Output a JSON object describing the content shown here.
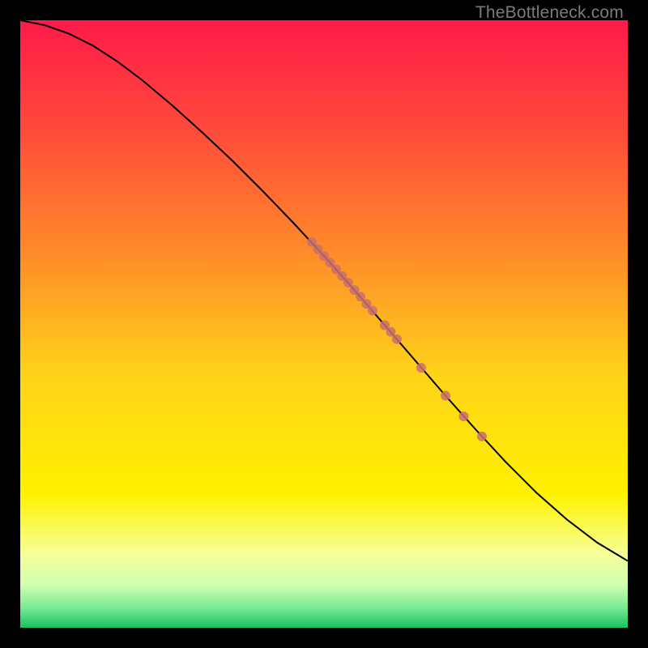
{
  "watermark": "TheBottleneck.com",
  "chart_data": {
    "type": "line",
    "title": "",
    "xlabel": "",
    "ylabel": "",
    "xlim": [
      0,
      100
    ],
    "ylim": [
      0,
      100
    ],
    "grid": false,
    "legend": false,
    "background_gradient": {
      "stops": [
        {
          "offset": 0.0,
          "color": "#ff1a4a"
        },
        {
          "offset": 0.18,
          "color": "#ff4a3a"
        },
        {
          "offset": 0.38,
          "color": "#ff8a2a"
        },
        {
          "offset": 0.58,
          "color": "#ffd21a"
        },
        {
          "offset": 0.78,
          "color": "#fff200"
        },
        {
          "offset": 0.88,
          "color": "#f6ff9a"
        },
        {
          "offset": 0.93,
          "color": "#d0ffb0"
        },
        {
          "offset": 0.97,
          "color": "#70e890"
        },
        {
          "offset": 1.0,
          "color": "#18c060"
        }
      ]
    },
    "series": [
      {
        "name": "curve",
        "style": "line",
        "color": "#000000",
        "points": [
          {
            "x": 0,
            "y": 100
          },
          {
            "x": 4,
            "y": 99.2
          },
          {
            "x": 8,
            "y": 97.8
          },
          {
            "x": 12,
            "y": 95.8
          },
          {
            "x": 16,
            "y": 93.2
          },
          {
            "x": 20,
            "y": 90.2
          },
          {
            "x": 25,
            "y": 86.0
          },
          {
            "x": 30,
            "y": 81.5
          },
          {
            "x": 35,
            "y": 76.8
          },
          {
            "x": 40,
            "y": 71.8
          },
          {
            "x": 45,
            "y": 66.6
          },
          {
            "x": 50,
            "y": 61.2
          },
          {
            "x": 55,
            "y": 55.6
          },
          {
            "x": 60,
            "y": 49.8
          },
          {
            "x": 65,
            "y": 44.0
          },
          {
            "x": 70,
            "y": 38.2
          },
          {
            "x": 75,
            "y": 32.6
          },
          {
            "x": 80,
            "y": 27.2
          },
          {
            "x": 85,
            "y": 22.2
          },
          {
            "x": 90,
            "y": 17.8
          },
          {
            "x": 95,
            "y": 14.0
          },
          {
            "x": 100,
            "y": 11.0
          }
        ]
      },
      {
        "name": "highlighted-points",
        "style": "scatter",
        "color": "#c9706f",
        "radius": 6,
        "points": [
          {
            "x": 48,
            "y": 63.5
          },
          {
            "x": 49,
            "y": 62.3
          },
          {
            "x": 50,
            "y": 61.2
          },
          {
            "x": 51,
            "y": 60.1
          },
          {
            "x": 52,
            "y": 59.0
          },
          {
            "x": 53,
            "y": 57.9
          },
          {
            "x": 54,
            "y": 56.8
          },
          {
            "x": 55,
            "y": 55.6
          },
          {
            "x": 56,
            "y": 54.5
          },
          {
            "x": 57,
            "y": 53.3
          },
          {
            "x": 58,
            "y": 52.2
          },
          {
            "x": 60,
            "y": 49.8
          },
          {
            "x": 61,
            "y": 48.7
          },
          {
            "x": 62,
            "y": 47.5
          },
          {
            "x": 66,
            "y": 42.8
          },
          {
            "x": 70,
            "y": 38.2
          },
          {
            "x": 73,
            "y": 34.8
          },
          {
            "x": 76,
            "y": 31.5
          }
        ]
      }
    ]
  }
}
